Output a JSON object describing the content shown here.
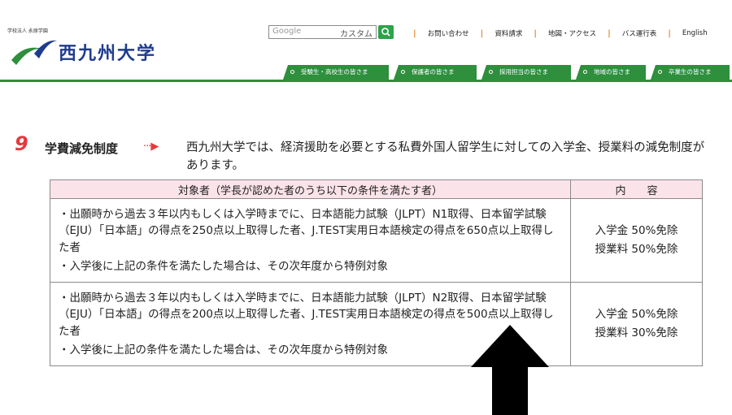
{
  "header": {
    "corp_small": "学校法人 永原学園",
    "university_name": "西九州大学",
    "search": {
      "google_label": "Google",
      "custom_label": "カスタム"
    },
    "top_links": [
      "お問い合わせ",
      "資料請求",
      "地図・アクセス",
      "バス運行表",
      "English"
    ],
    "tabs": [
      "受験生・高校生の皆さま",
      "保護者の皆さま",
      "採用担当の皆さま",
      "地域の皆さま",
      "卒業生の皆さま"
    ]
  },
  "section": {
    "number": "9",
    "title": "学費減免制度",
    "arrow": "···▶",
    "description": "西九州大学では、経済援助を必要とする私費外国人留学生に対しての入学金、授業料の減免制度があります。"
  },
  "table": {
    "headers": {
      "condition": "対象者（学長が認めた者のうち以下の条件を満たす者）",
      "content": "内　　容"
    },
    "rows": [
      {
        "condition": "・出願時から過去３年以内もしくは入学時までに、日本語能力試験（JLPT）N1取得、日本留学試験（EJU）「日本語」の得点を250点以上取得した者、J.TEST実用日本語検定の得点を650点以上取得した者",
        "note": "・入学後に上記の条件を満たした場合は、その次年度から特例対象",
        "content_1": "入学金 50%免除",
        "content_2": "授業料 50%免除"
      },
      {
        "condition": "・出願時から過去３年以内もしくは入学時までに、日本語能力試験（JLPT）N2取得、日本留学試験（EJU）「日本語」の得点を200点以上取得した者、J.TEST実用日本語検定の得点を500点以上取得した者",
        "note": "・入学後に上記の条件を満たした場合は、その次年度から特例対象",
        "content_1": "入学金 50%免除",
        "content_2": "授業料 30%免除"
      }
    ]
  },
  "colors": {
    "brand_green": "#2e8f3c",
    "brand_blue": "#1f3b8f",
    "accent_red": "#e8383d",
    "table_header_pink": "#fbe3ea"
  }
}
